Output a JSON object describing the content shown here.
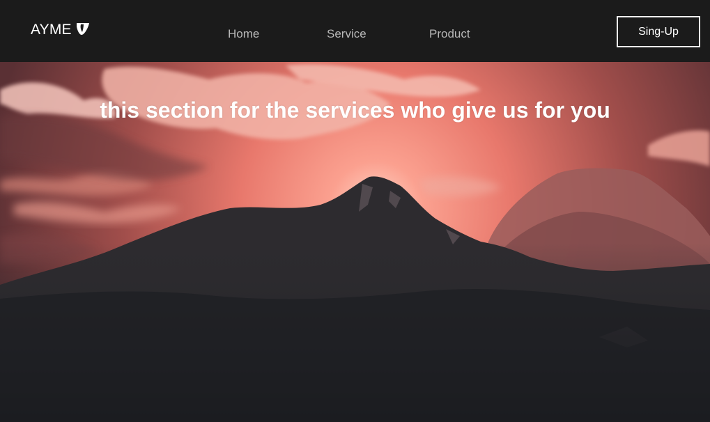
{
  "navbar": {
    "brand": "AYME",
    "brand_logo_icon": "typo3-logo-icon",
    "links": [
      "Home",
      "Service",
      "Product"
    ],
    "signup_label": "Sing-Up"
  },
  "hero": {
    "title": "this section for the services who give us for you"
  },
  "colors": {
    "nav_bg": "#1b1b1b",
    "nav_link": "#b9b9b9",
    "sky_glow": "#f07a6e",
    "mountain_dark": "#232326"
  }
}
